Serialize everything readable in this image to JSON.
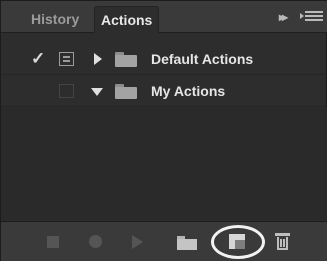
{
  "tabs": [
    {
      "label": "History",
      "active": false
    },
    {
      "label": "Actions",
      "active": true
    }
  ],
  "tab_bar_buttons": {
    "collapse_icon": "double-chevron-right-icon",
    "menu_icon": "panel-menu-icon"
  },
  "rows": [
    {
      "label": "Default Actions",
      "checked": true,
      "expanded": false,
      "type": "action-set"
    },
    {
      "label": "My Actions",
      "checked": false,
      "expanded": true,
      "type": "action-set"
    }
  ],
  "toolbar": {
    "buttons": [
      {
        "name": "stop",
        "icon": "stop-icon",
        "enabled": false
      },
      {
        "name": "record",
        "icon": "record-icon",
        "enabled": false
      },
      {
        "name": "play",
        "icon": "play-icon",
        "enabled": false
      },
      {
        "name": "new-set",
        "icon": "folder-icon",
        "enabled": true
      },
      {
        "name": "new-action",
        "icon": "new-action-icon",
        "enabled": true,
        "highlighted": true
      },
      {
        "name": "delete",
        "icon": "trash-icon",
        "enabled": true
      }
    ]
  },
  "colors": {
    "panel_bg": "#2d2d2d",
    "tab_bar_bg": "#3a3a3a",
    "text": "#e6e6e6",
    "inactive_tab": "#9b9b9b",
    "highlight_ring": "#f2f2f2"
  }
}
